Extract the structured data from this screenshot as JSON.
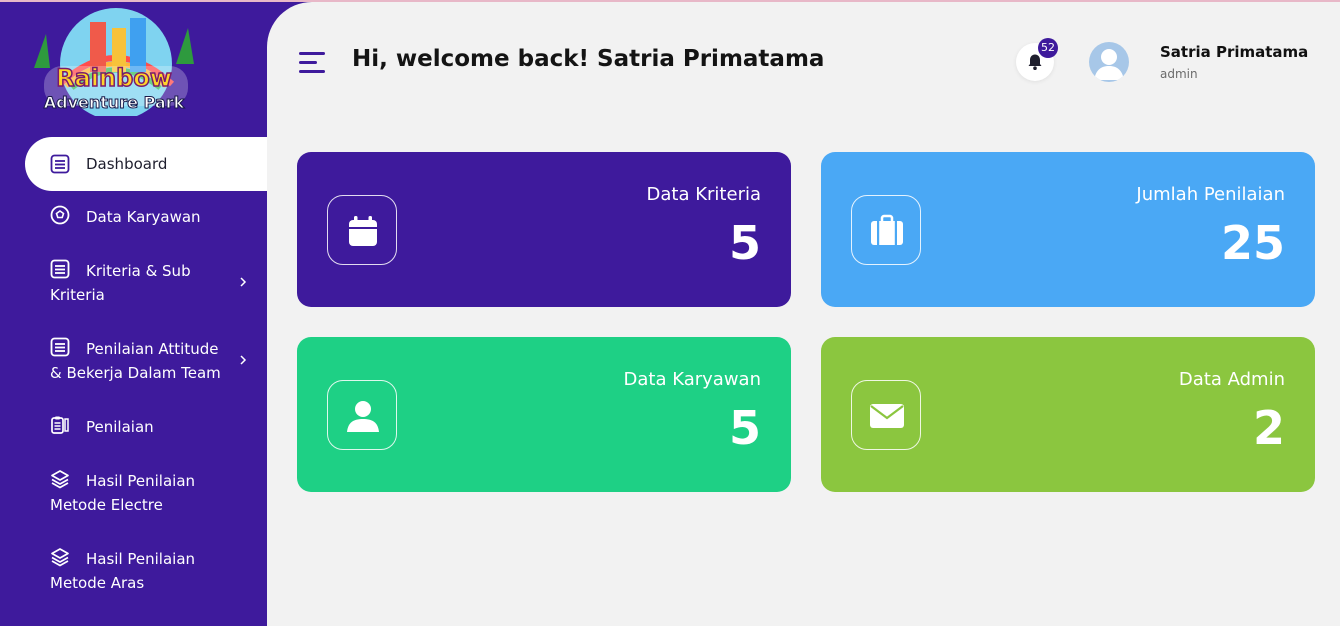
{
  "app": {
    "logo_line1": "Rainbow",
    "logo_line2": "Adventure Park"
  },
  "sidebar": {
    "items": [
      {
        "label": "Dashboard",
        "icon": "list-icon",
        "active": true
      },
      {
        "label": "Data Karyawan",
        "icon": "soccer-ball-icon"
      },
      {
        "label": "Kriteria & Sub Kriteria",
        "icon": "list-icon",
        "has_submenu": true
      },
      {
        "label": "Penilaian Attitude & Bekerja Dalam Team",
        "icon": "list-icon",
        "has_submenu": true
      },
      {
        "label": "Penilaian",
        "icon": "clipboard-pencil-icon"
      },
      {
        "label": "Hasil Penilaian Metode Electre",
        "icon": "layers-icon"
      },
      {
        "label": "Hasil Penilaian Metode Aras",
        "icon": "layers-icon"
      }
    ]
  },
  "header": {
    "welcome": "Hi, welcome back! Satria Primatama",
    "notification_count": "52",
    "user_name": "Satria Primatama",
    "user_role": "admin"
  },
  "cards": [
    {
      "label": "Data Kriteria",
      "value": "5",
      "icon": "calendar-icon",
      "color": "#3e1a9c"
    },
    {
      "label": "Jumlah Penilaian",
      "value": "25",
      "icon": "briefcase-icon",
      "color": "#4aa8f5"
    },
    {
      "label": "Data Karyawan",
      "value": "5",
      "icon": "user-icon",
      "color": "#1ed085"
    },
    {
      "label": "Data Admin",
      "value": "2",
      "icon": "envelope-icon",
      "color": "#8bc63f"
    }
  ]
}
